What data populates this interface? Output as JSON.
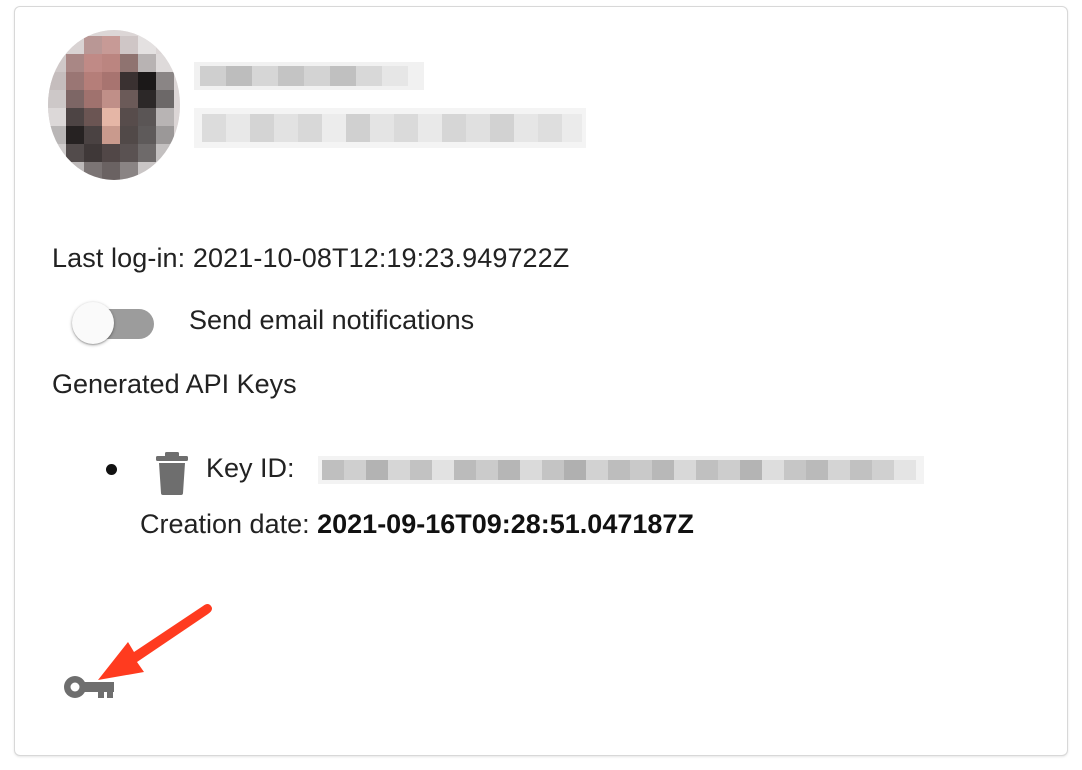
{
  "profile": {
    "avatar_alt": "avatar"
  },
  "last_login": {
    "label": "Last log-in:",
    "value": "2021-10-08T12:19:23.949722Z"
  },
  "notifications": {
    "label": "Send email notifications",
    "enabled": false
  },
  "api_keys": {
    "heading": "Generated API Keys",
    "items": [
      {
        "key_id_label": "Key ID:",
        "creation_label": "Creation date:",
        "creation_date": "2021-09-16T09:28:51.047187Z"
      }
    ]
  },
  "icons": {
    "delete": "trash-icon",
    "generate": "key-icon",
    "annotation": "arrow-icon"
  },
  "colors": {
    "annotation_arrow": "#ff3b1f",
    "icon_gray": "#6e6e6e",
    "toggle_track": "#9c9c9c"
  }
}
